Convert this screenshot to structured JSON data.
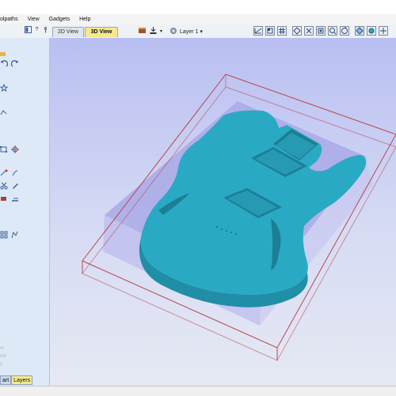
{
  "menu": {
    "items": [
      "olpaths",
      "View",
      "Gadgets",
      "Help"
    ]
  },
  "toolbar": {
    "question_icon": "?",
    "tab_2d": "2D View",
    "tab_3d": "3D View",
    "layer_label": "Layer 1",
    "dropdown_arrow": "▾"
  },
  "view_buttons": [
    "iso-view-icon",
    "front-view-icon",
    "grid-icon",
    "left-view-icon",
    "top-view-icon",
    "zoom-extents-icon",
    "zoom-box-icon",
    "rotate-icon",
    "layers-icon",
    "settings-icon",
    "more-icon"
  ],
  "sidebar": {
    "bottom_tabs": [
      "art",
      "Layers"
    ],
    "faded_text": [
      "m",
      "om",
      "s"
    ]
  },
  "colors": {
    "viewport_top": "#b9bff2",
    "viewport_bottom": "#e6e9f3",
    "guitar_body": "#2aa9c4",
    "material_block": "#aaa9e6",
    "bounding_box": "#b8484b",
    "active_tab": "#f4e98f",
    "sidebar_bg": "#dde9f6"
  }
}
